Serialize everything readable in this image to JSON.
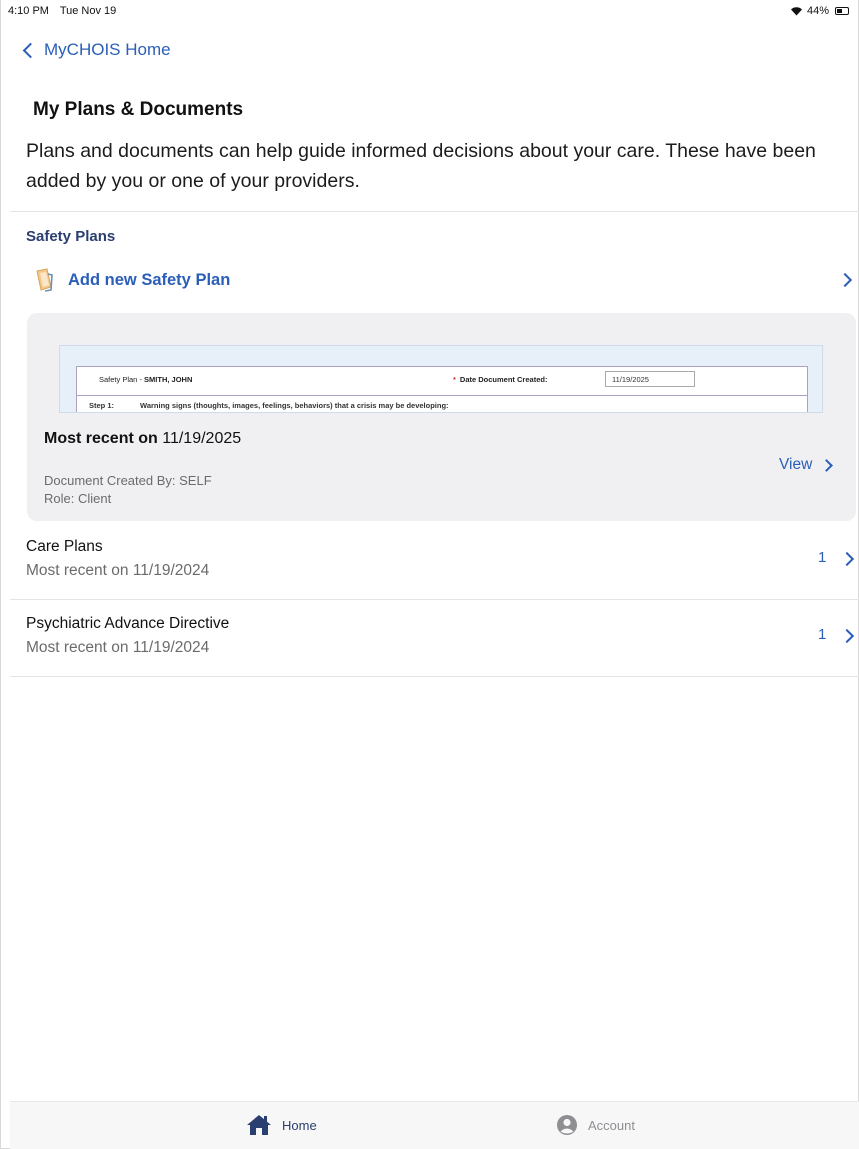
{
  "status_bar": {
    "time": "4:10 PM",
    "date": "Tue Nov 19",
    "battery": "44%"
  },
  "nav": {
    "back_label": "MyCHOIS Home"
  },
  "page": {
    "title": "My Plans & Documents",
    "intro": "Plans and documents can help guide informed decisions about your care. These have been added by you or one of your providers."
  },
  "safety_plans": {
    "section_title": "Safety Plans",
    "add_label": "Add new Safety Plan",
    "preview": {
      "title_prefix": "Safety Plan - ",
      "patient_name": "SMITH, JOHN",
      "date_label": "Date Document Created:",
      "date_value": "11/19/2025",
      "step_label": "Step 1:",
      "step_text": "Warning signs (thoughts, images, feelings, behaviors) that a crisis may be developing:"
    },
    "recent_prefix": "Most recent on",
    "recent_date": "11/19/2025",
    "created_by": "Document Created By: SELF",
    "role": "Role: Client",
    "view_label": "View"
  },
  "categories": [
    {
      "title": "Care Plans",
      "subtitle": "Most recent on 11/19/2024",
      "count": "1"
    },
    {
      "title": "Psychiatric Advance Directive",
      "subtitle": "Most recent on 11/19/2024",
      "count": "1"
    }
  ],
  "tab_bar": {
    "home_label": "Home",
    "account_label": "Account"
  },
  "colors": {
    "accent": "#2b5eb8",
    "section_title": "#2a3f6f",
    "card_background": "#f0f0f2"
  }
}
